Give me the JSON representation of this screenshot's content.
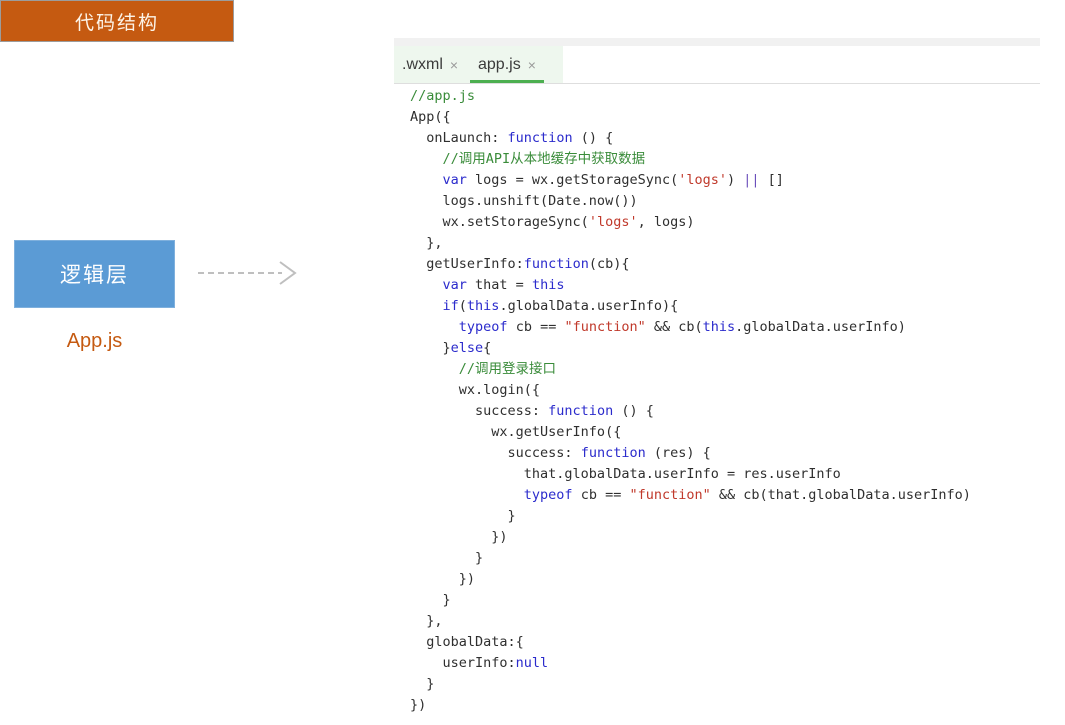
{
  "diagram": {
    "section_title": "代码结构",
    "layer_box_label": "逻辑层",
    "file_label": "App.js",
    "arrow_name": "dashed-right-arrow",
    "colors": {
      "header_orange": "#c55a11",
      "layer_blue": "#5b9bd5",
      "file_label_orange": "#c55a11",
      "arrow_gray": "#bfbfbf"
    }
  },
  "editor": {
    "tabs": [
      {
        "label": ".wxml",
        "close_icon": "×",
        "active": false
      },
      {
        "label": "app.js",
        "close_icon": "×",
        "active": true
      }
    ],
    "active_tab_accent": "#4caf50",
    "code_lines": [
      [
        {
          "t": "//app.js",
          "c": "com"
        }
      ],
      [
        {
          "t": "App({",
          "c": "pln"
        }
      ],
      [
        {
          "t": "  onLaunch: ",
          "c": "pln"
        },
        {
          "t": "function",
          "c": "kw"
        },
        {
          "t": " () {",
          "c": "pln"
        }
      ],
      [
        {
          "t": "    //调用API从本地缓存中获取数据",
          "c": "com"
        }
      ],
      [
        {
          "t": "    ",
          "c": "pln"
        },
        {
          "t": "var",
          "c": "kw"
        },
        {
          "t": " logs = wx.getStorageSync(",
          "c": "pln"
        },
        {
          "t": "'logs'",
          "c": "str"
        },
        {
          "t": ") ",
          "c": "pln"
        },
        {
          "t": "||",
          "c": "op"
        },
        {
          "t": " []",
          "c": "pln"
        }
      ],
      [
        {
          "t": "    logs.unshift(Date.now())",
          "c": "pln"
        }
      ],
      [
        {
          "t": "    wx.setStorageSync(",
          "c": "pln"
        },
        {
          "t": "'logs'",
          "c": "str"
        },
        {
          "t": ", logs)",
          "c": "pln"
        }
      ],
      [
        {
          "t": "  },",
          "c": "pln"
        }
      ],
      [
        {
          "t": "  getUserInfo:",
          "c": "pln"
        },
        {
          "t": "function",
          "c": "kw"
        },
        {
          "t": "(cb){",
          "c": "pln"
        }
      ],
      [
        {
          "t": "    ",
          "c": "pln"
        },
        {
          "t": "var",
          "c": "kw"
        },
        {
          "t": " that = ",
          "c": "pln"
        },
        {
          "t": "this",
          "c": "kw"
        }
      ],
      [
        {
          "t": "    ",
          "c": "pln"
        },
        {
          "t": "if",
          "c": "kw"
        },
        {
          "t": "(",
          "c": "pln"
        },
        {
          "t": "this",
          "c": "kw"
        },
        {
          "t": ".globalData.userInfo){",
          "c": "pln"
        }
      ],
      [
        {
          "t": "      ",
          "c": "pln"
        },
        {
          "t": "typeof",
          "c": "kw"
        },
        {
          "t": " cb == ",
          "c": "pln"
        },
        {
          "t": "\"function\"",
          "c": "str"
        },
        {
          "t": " && cb(",
          "c": "pln"
        },
        {
          "t": "this",
          "c": "kw"
        },
        {
          "t": ".globalData.userInfo)",
          "c": "pln"
        }
      ],
      [
        {
          "t": "    }",
          "c": "pln"
        },
        {
          "t": "else",
          "c": "kw"
        },
        {
          "t": "{",
          "c": "pln"
        }
      ],
      [
        {
          "t": "      //调用登录接口",
          "c": "com"
        }
      ],
      [
        {
          "t": "      wx.login({",
          "c": "pln"
        }
      ],
      [
        {
          "t": "        success: ",
          "c": "pln"
        },
        {
          "t": "function",
          "c": "kw"
        },
        {
          "t": " () {",
          "c": "pln"
        }
      ],
      [
        {
          "t": "          wx.getUserInfo({",
          "c": "pln"
        }
      ],
      [
        {
          "t": "            success: ",
          "c": "pln"
        },
        {
          "t": "function",
          "c": "kw"
        },
        {
          "t": " (res) {",
          "c": "pln"
        }
      ],
      [
        {
          "t": "              that.globalData.userInfo = res.userInfo",
          "c": "pln"
        }
      ],
      [
        {
          "t": "              ",
          "c": "pln"
        },
        {
          "t": "typeof",
          "c": "kw"
        },
        {
          "t": " cb == ",
          "c": "pln"
        },
        {
          "t": "\"function\"",
          "c": "str"
        },
        {
          "t": " && cb(that.globalData.userInfo)",
          "c": "pln"
        }
      ],
      [
        {
          "t": "            }",
          "c": "pln"
        }
      ],
      [
        {
          "t": "          })",
          "c": "pln"
        }
      ],
      [
        {
          "t": "        }",
          "c": "pln"
        }
      ],
      [
        {
          "t": "      })",
          "c": "pln"
        }
      ],
      [
        {
          "t": "    }",
          "c": "pln"
        }
      ],
      [
        {
          "t": "  },",
          "c": "pln"
        }
      ],
      [
        {
          "t": "  globalData:{",
          "c": "pln"
        }
      ],
      [
        {
          "t": "    userInfo:",
          "c": "pln"
        },
        {
          "t": "null",
          "c": "kw"
        }
      ],
      [
        {
          "t": "  }",
          "c": "pln"
        }
      ],
      [
        {
          "t": "})",
          "c": "pln"
        }
      ]
    ]
  }
}
